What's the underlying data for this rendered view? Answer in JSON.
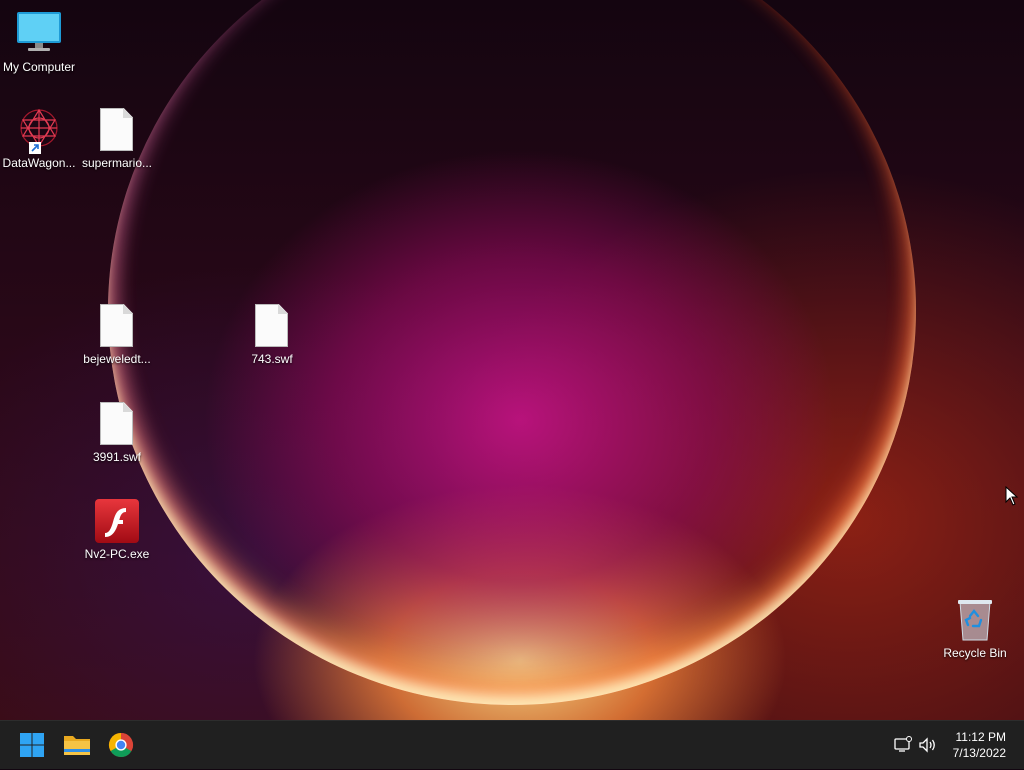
{
  "desktop": {
    "icons": [
      {
        "label": "My Computer",
        "icon": "monitor-icon"
      },
      {
        "label": "DataWagon...",
        "icon": "datawagon-shortcut-icon"
      },
      {
        "label": "supermario...",
        "icon": "file-icon"
      },
      {
        "label": "bejeweledt...",
        "icon": "file-icon"
      },
      {
        "label": "743.swf",
        "icon": "file-icon"
      },
      {
        "label": "3991.swf",
        "icon": "file-icon"
      },
      {
        "label": "Nv2-PC.exe",
        "icon": "flash-icon"
      },
      {
        "label": "Recycle Bin",
        "icon": "recycle-bin-icon"
      }
    ]
  },
  "taskbar": {
    "pinned": [
      "windows-start-icon",
      "file-explorer-icon",
      "chrome-icon"
    ],
    "tray": [
      "network-icon",
      "volume-icon"
    ],
    "clock": {
      "time": "11:12 PM",
      "date": "7/13/2022"
    }
  },
  "colors": {
    "taskbar": "#202020",
    "start_blue": "#2fa4f3",
    "flash_red": "#c8101b",
    "folder_yellow": "#f6c344"
  }
}
